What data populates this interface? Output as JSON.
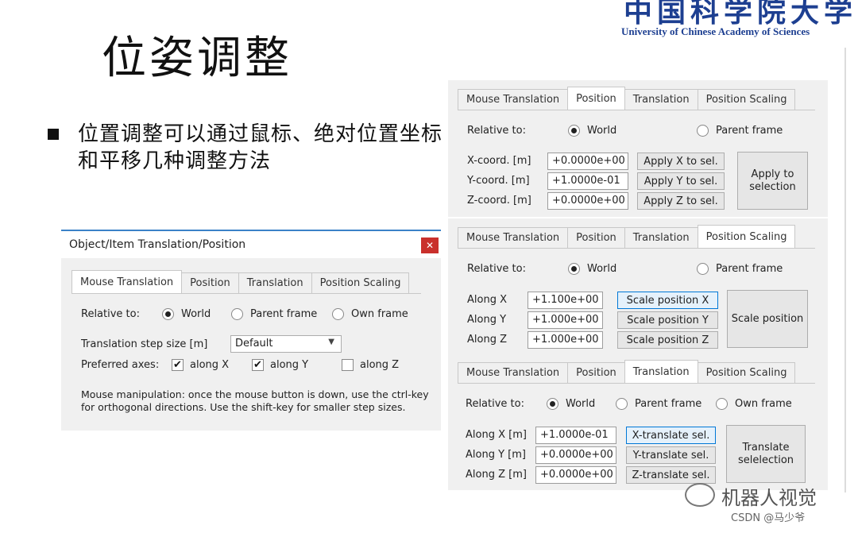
{
  "header": {
    "logo_cn": "中国科学院大学",
    "logo_en": "University of  Chinese Academy of Sciences",
    "title": "位姿调整",
    "bullet": "位置调整可以通过鼠标、绝对位置坐标和平移几种调整方法"
  },
  "tab_labels": [
    "Mouse Translation",
    "Position",
    "Translation",
    "Position Scaling"
  ],
  "left_dialog": {
    "title": "Object/Item Translation/Position",
    "close_icon": "close-icon",
    "relative_to_label": "Relative to:",
    "radios": [
      "World",
      "Parent frame",
      "Own frame"
    ],
    "selected_radio": "World",
    "step_label": "Translation step size [m]",
    "step_value": "Default",
    "axes_label": "Preferred axes:",
    "axes": [
      {
        "label": "along X",
        "checked": true
      },
      {
        "label": "along Y",
        "checked": true
      },
      {
        "label": "along Z",
        "checked": false
      }
    ],
    "checkmark": "✔",
    "note": "Mouse manipulation: once the mouse button is down, use the ctrl-key for orthogonal directions. Use the shift-key for smaller step sizes."
  },
  "position_panel": {
    "relative_to_label": "Relative to:",
    "radios": [
      "World",
      "Parent frame"
    ],
    "rows": [
      {
        "label": "X-coord. [m]",
        "value": "+0.0000e+00",
        "button": "Apply X to sel."
      },
      {
        "label": "Y-coord. [m]",
        "value": "+1.0000e-01",
        "button": "Apply Y to sel."
      },
      {
        "label": "Z-coord. [m]",
        "value": "+0.0000e+00",
        "button": "Apply Z to sel."
      }
    ],
    "big_button": "Apply to selection"
  },
  "scaling_panel": {
    "relative_to_label": "Relative to:",
    "radios": [
      "World",
      "Parent frame"
    ],
    "rows": [
      {
        "label": "Along X",
        "value": "+1.100e+00",
        "button": "Scale position X"
      },
      {
        "label": "Along Y",
        "value": "+1.000e+00",
        "button": "Scale position Y"
      },
      {
        "label": "Along Z",
        "value": "+1.000e+00",
        "button": "Scale position Z"
      }
    ],
    "big_button": "Scale position"
  },
  "translation_panel": {
    "relative_to_label": "Relative to:",
    "radios": [
      "World",
      "Parent frame",
      "Own frame"
    ],
    "rows": [
      {
        "label": "Along X [m]",
        "value": "+1.0000e-01",
        "button": "X-translate sel."
      },
      {
        "label": "Along Y [m]",
        "value": "+0.0000e+00",
        "button": "Y-translate sel."
      },
      {
        "label": "Along Z [m]",
        "value": "+0.0000e+00",
        "button": "Z-translate sel."
      }
    ],
    "big_button": "Translate selelection"
  },
  "watermark": {
    "text": "机器人视觉",
    "icon": "wechat-icon",
    "credit": "CSDN @马少爷"
  }
}
